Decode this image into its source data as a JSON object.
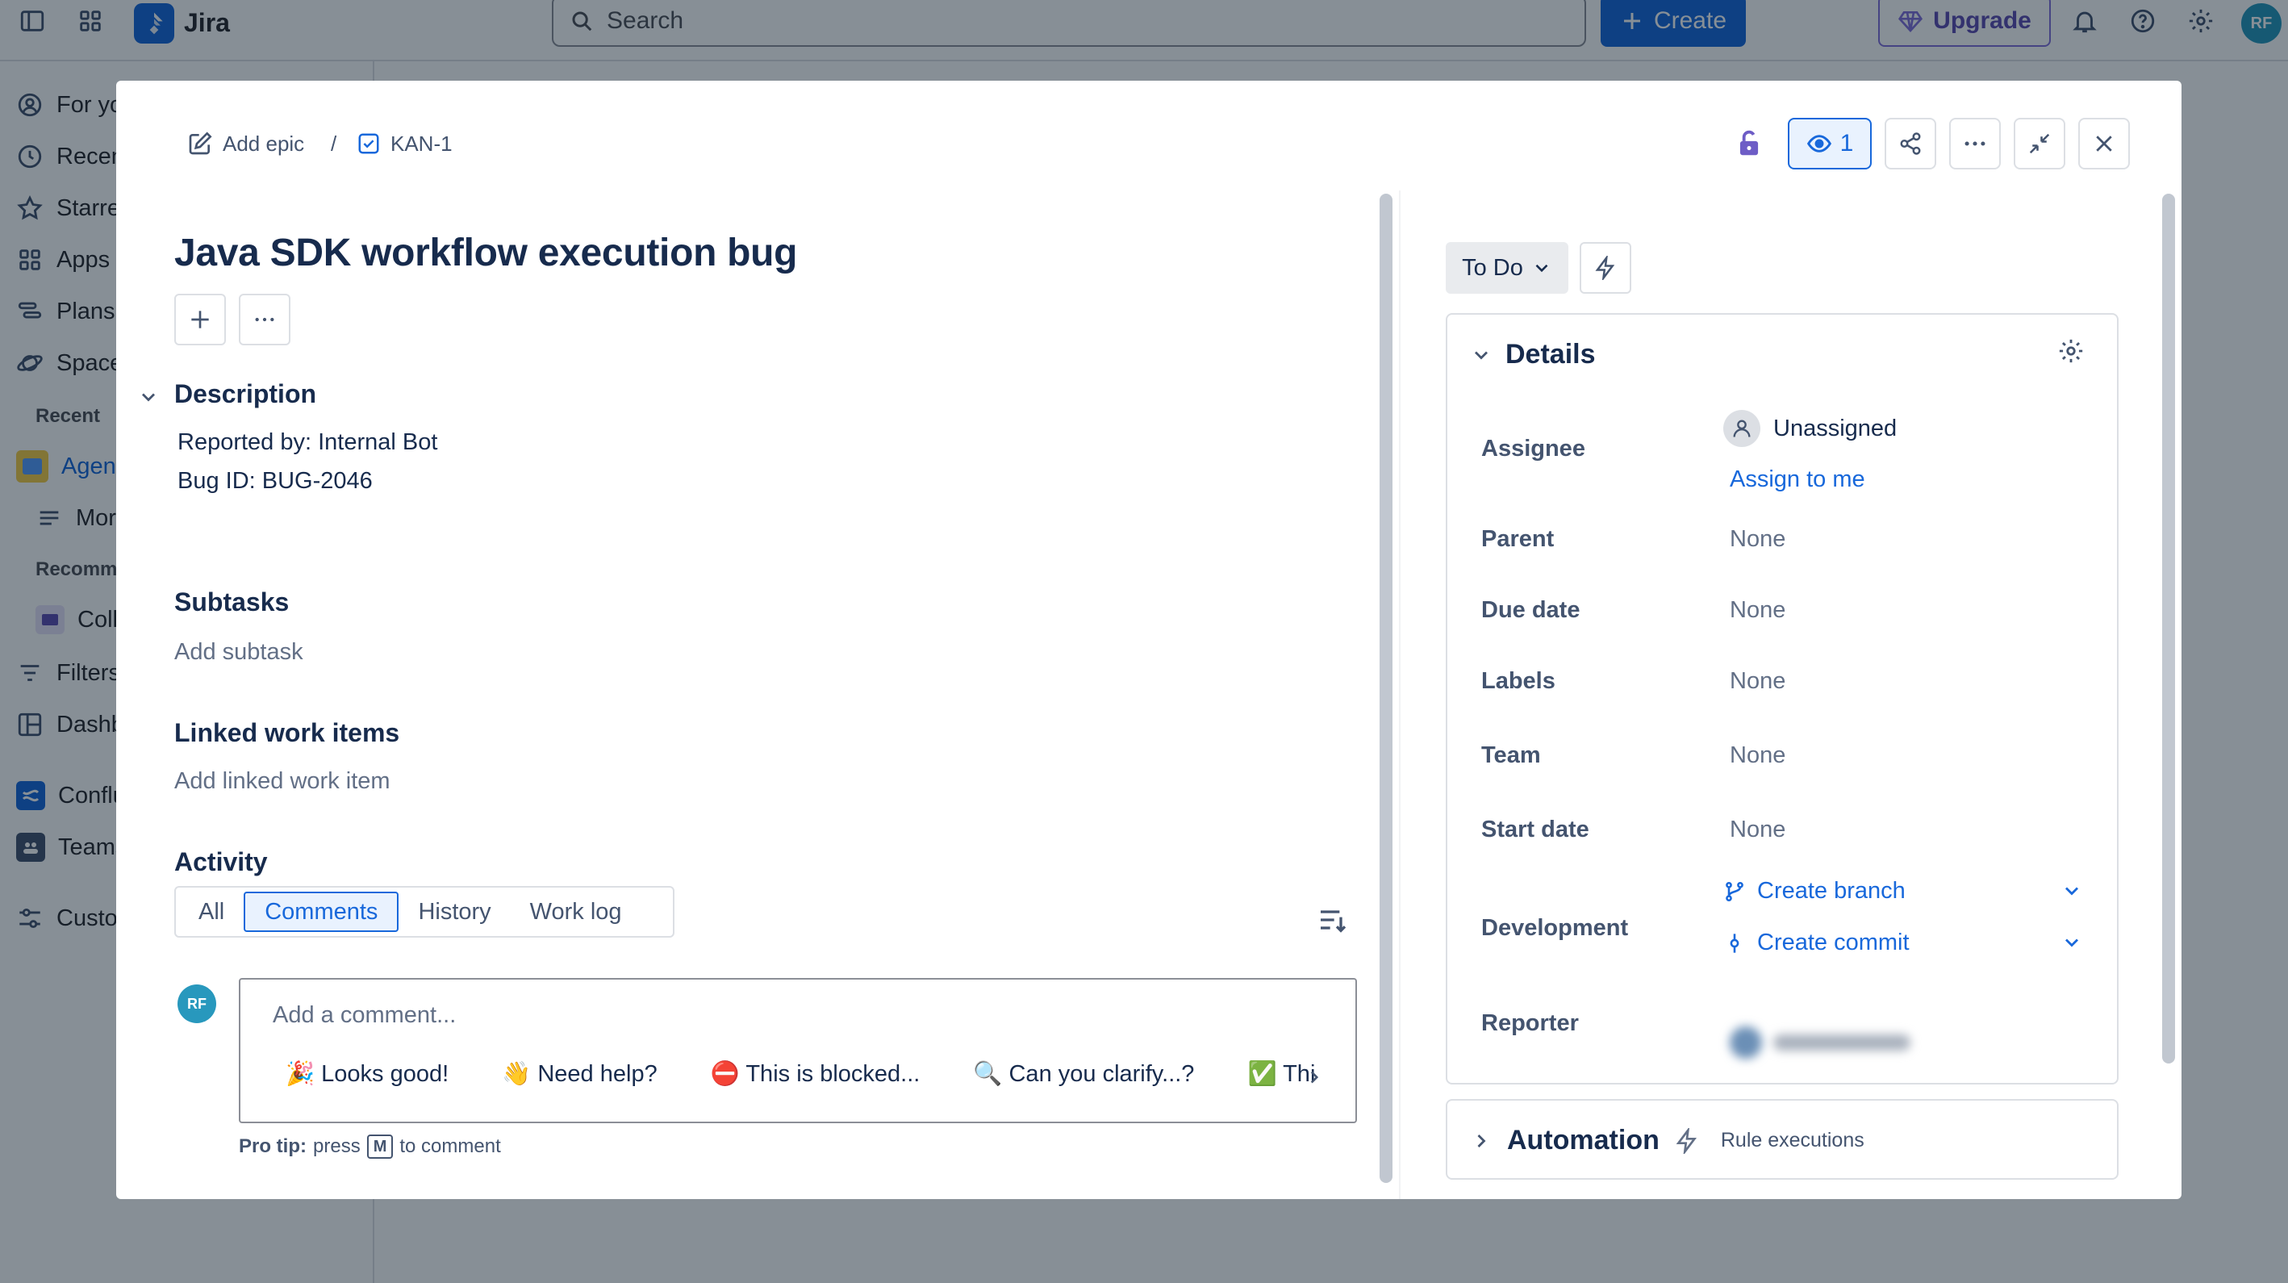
{
  "topbar": {
    "app_name": "Jira",
    "search_placeholder": "Search",
    "create_label": "Create",
    "upgrade_label": "Upgrade",
    "avatar_initials": "RF"
  },
  "sidebar": {
    "items": [
      {
        "label": "For you",
        "icon": "person-circle-icon"
      },
      {
        "label": "Recent",
        "icon": "clock-icon"
      },
      {
        "label": "Starred",
        "icon": "star-icon"
      },
      {
        "label": "Apps",
        "icon": "apps-grid-icon"
      },
      {
        "label": "Plans",
        "icon": "plans-icon"
      },
      {
        "label": "Spaces",
        "icon": "planet-icon"
      }
    ],
    "recent_heading": "Recent",
    "recent_items": [
      {
        "label": "Agent"
      },
      {
        "label": "More spaces"
      }
    ],
    "recommended_heading": "Recommended",
    "recommended_items": [
      {
        "label": "Collaborate"
      }
    ],
    "bottom_items": [
      {
        "label": "Filters"
      },
      {
        "label": "Dashboards"
      },
      {
        "label": "Confluence"
      },
      {
        "label": "Teams"
      },
      {
        "label": "Customize sidebar"
      }
    ]
  },
  "modal": {
    "breadcrumb": {
      "add_epic": "Add epic",
      "separator": "/",
      "issue_key": "KAN-1"
    },
    "watch_count": "1",
    "title": "Java SDK workflow execution bug",
    "description": {
      "heading": "Description",
      "lines": [
        "Reported by: Internal Bot",
        "Bug ID: BUG-2046"
      ]
    },
    "subtasks": {
      "heading": "Subtasks",
      "add_label": "Add subtask"
    },
    "linked": {
      "heading": "Linked work items",
      "add_label": "Add linked work item"
    },
    "activity": {
      "heading": "Activity",
      "tabs": [
        "All",
        "Comments",
        "History",
        "Work log"
      ],
      "active_tab": "Comments",
      "comment_avatar": "RF",
      "comment_placeholder": "Add a comment...",
      "quick_replies": [
        "🎉 Looks good!",
        "👋 Need help?",
        "⛔ This is blocked...",
        "🔍 Can you clarify...?",
        "✅ Thi"
      ],
      "protip_bold": "Pro tip:",
      "protip_press": "press",
      "protip_key": "M",
      "protip_rest": "to comment"
    },
    "status": "To Do",
    "details": {
      "heading": "Details",
      "fields": {
        "assignee_label": "Assignee",
        "assignee_value": "Unassigned",
        "assign_to_me": "Assign to me",
        "parent_label": "Parent",
        "parent_value": "None",
        "due_label": "Due date",
        "due_value": "None",
        "labels_label": "Labels",
        "labels_value": "None",
        "team_label": "Team",
        "team_value": "None",
        "start_label": "Start date",
        "start_value": "None",
        "development_label": "Development",
        "create_branch": "Create branch",
        "create_commit": "Create commit",
        "reporter_label": "Reporter"
      }
    },
    "automation": {
      "heading": "Automation",
      "rule_executions": "Rule executions"
    }
  },
  "colors": {
    "brand_blue": "#1868db",
    "upgrade_purple": "#5e4db2",
    "avatar_teal": "#2898bd",
    "overlay": "rgba(5,21,36,0.48)"
  }
}
